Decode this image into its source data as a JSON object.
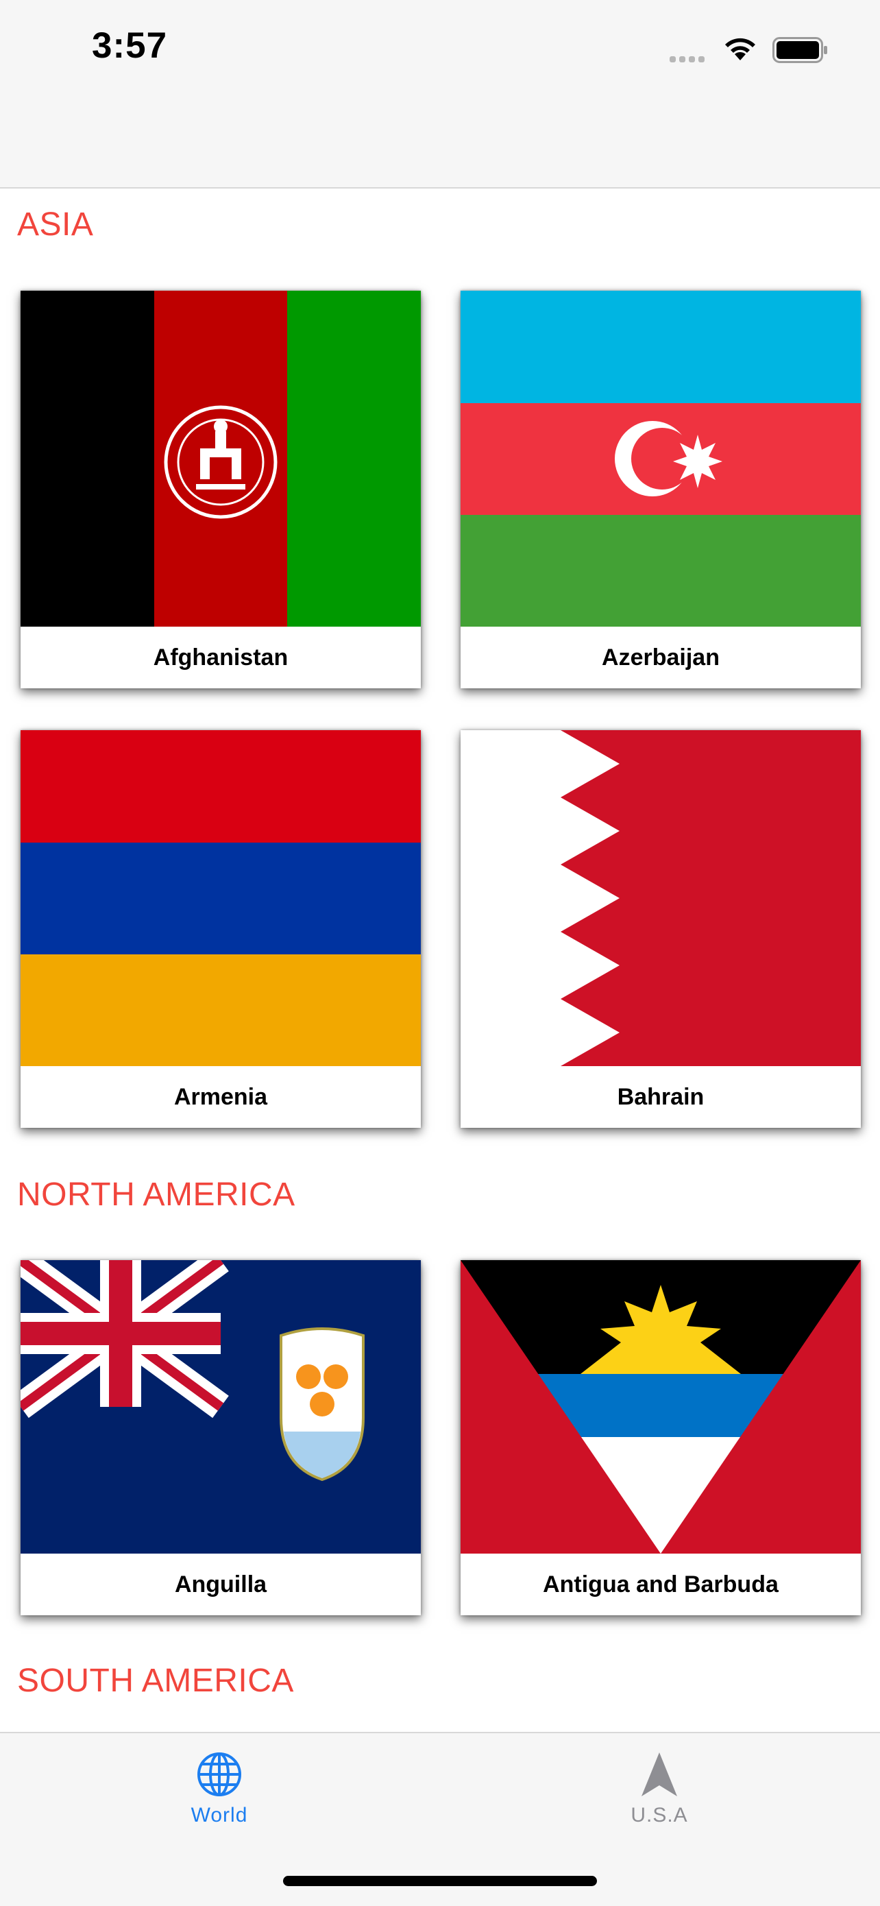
{
  "status_bar": {
    "time": "3:57"
  },
  "sections": [
    {
      "title": "ASIA",
      "countries": [
        "Afghanistan",
        "Azerbaijan",
        "Armenia",
        "Bahrain"
      ]
    },
    {
      "title": "NORTH AMERICA",
      "countries": [
        "Anguilla",
        "Antigua and Barbuda"
      ]
    },
    {
      "title": "SOUTH AMERICA"
    }
  ],
  "tabbar": {
    "items": [
      {
        "label": "World",
        "icon": "globe-icon",
        "selected": true
      },
      {
        "label": "U.S.A",
        "icon": "navigation-arrow-icon",
        "selected": false
      }
    ]
  },
  "colors": {
    "accent": "#1c7ef0",
    "section_title": "#f1453c",
    "inactive_tab": "#8e8e93"
  }
}
